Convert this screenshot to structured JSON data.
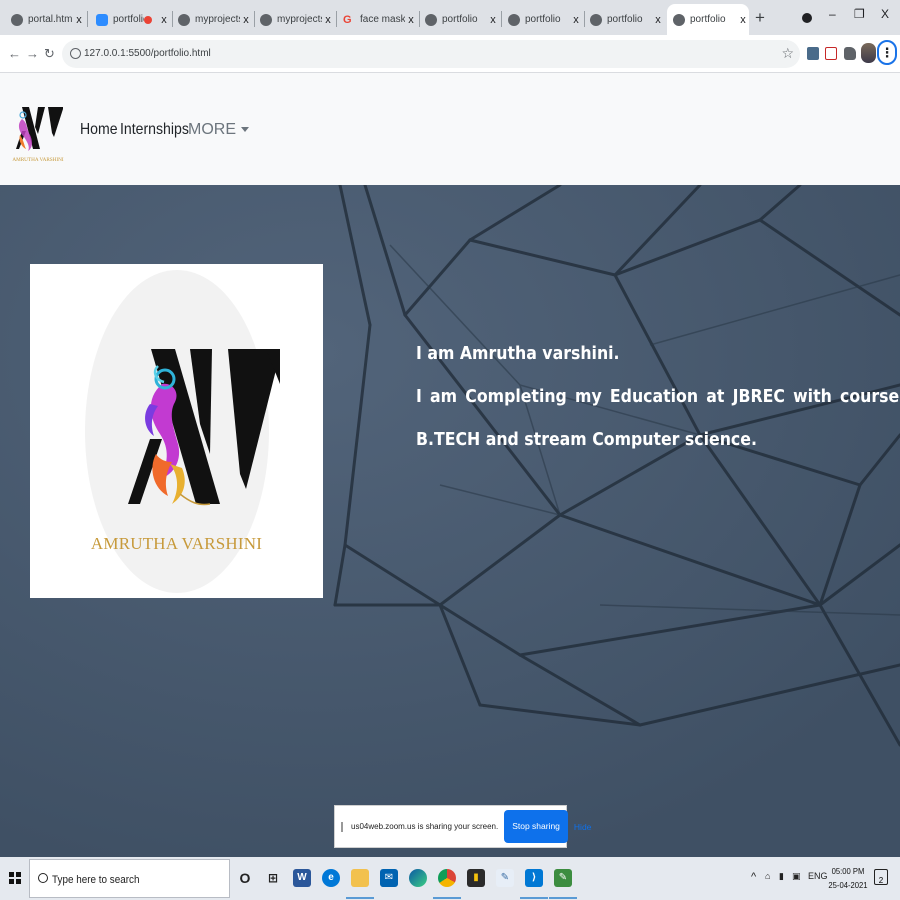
{
  "browser": {
    "tabs": [
      {
        "title": "portal.html",
        "favicon": "globe-icon"
      },
      {
        "title": "portfolio",
        "favicon": "zoom-icon",
        "recording": true
      },
      {
        "title": "myprojects",
        "favicon": "globe-icon"
      },
      {
        "title": "myprojects",
        "favicon": "globe-icon"
      },
      {
        "title": "face mask dete",
        "favicon": "google-icon"
      },
      {
        "title": "portfolio",
        "favicon": "globe-icon"
      },
      {
        "title": "portfolio",
        "favicon": "globe-icon"
      },
      {
        "title": "portfolio",
        "favicon": "globe-icon"
      },
      {
        "title": "portfolio",
        "favicon": "globe-icon",
        "active": true
      }
    ],
    "url": "127.0.0.1:5500/portfolio.html",
    "new_tab_glyph": "+",
    "close_glyph": "x",
    "window_controls": {
      "minimize": "–",
      "maximize": "❐",
      "close": "X"
    }
  },
  "page": {
    "logo_caption": "AMRUTHA VARSHINI",
    "nav": {
      "home": "Home",
      "internships": "Internships",
      "more": "MORE"
    },
    "hero": {
      "photo_caption": "AMRUTHA VARSHINI",
      "line1": "I am Amrutha varshini.",
      "line2_words": [
        "I",
        "am",
        "Completing",
        "my",
        "Education",
        "at",
        "JBREC",
        "with",
        "course"
      ],
      "line3": "B.TECH and stream Computer science."
    },
    "colors": {
      "hero_bg": "#45566b",
      "navbar_bg": "#f8f9fa",
      "logo_gold": "#c79a3b"
    }
  },
  "share_bar": {
    "message": "us04web.zoom.us is sharing your screen.",
    "stop_label": "Stop sharing",
    "hide_label": "Hide"
  },
  "taskbar": {
    "search_placeholder": "Type here to search",
    "language": "ENG",
    "time": "05:00 PM",
    "date": "25-04-2021",
    "notification_count": "2"
  }
}
